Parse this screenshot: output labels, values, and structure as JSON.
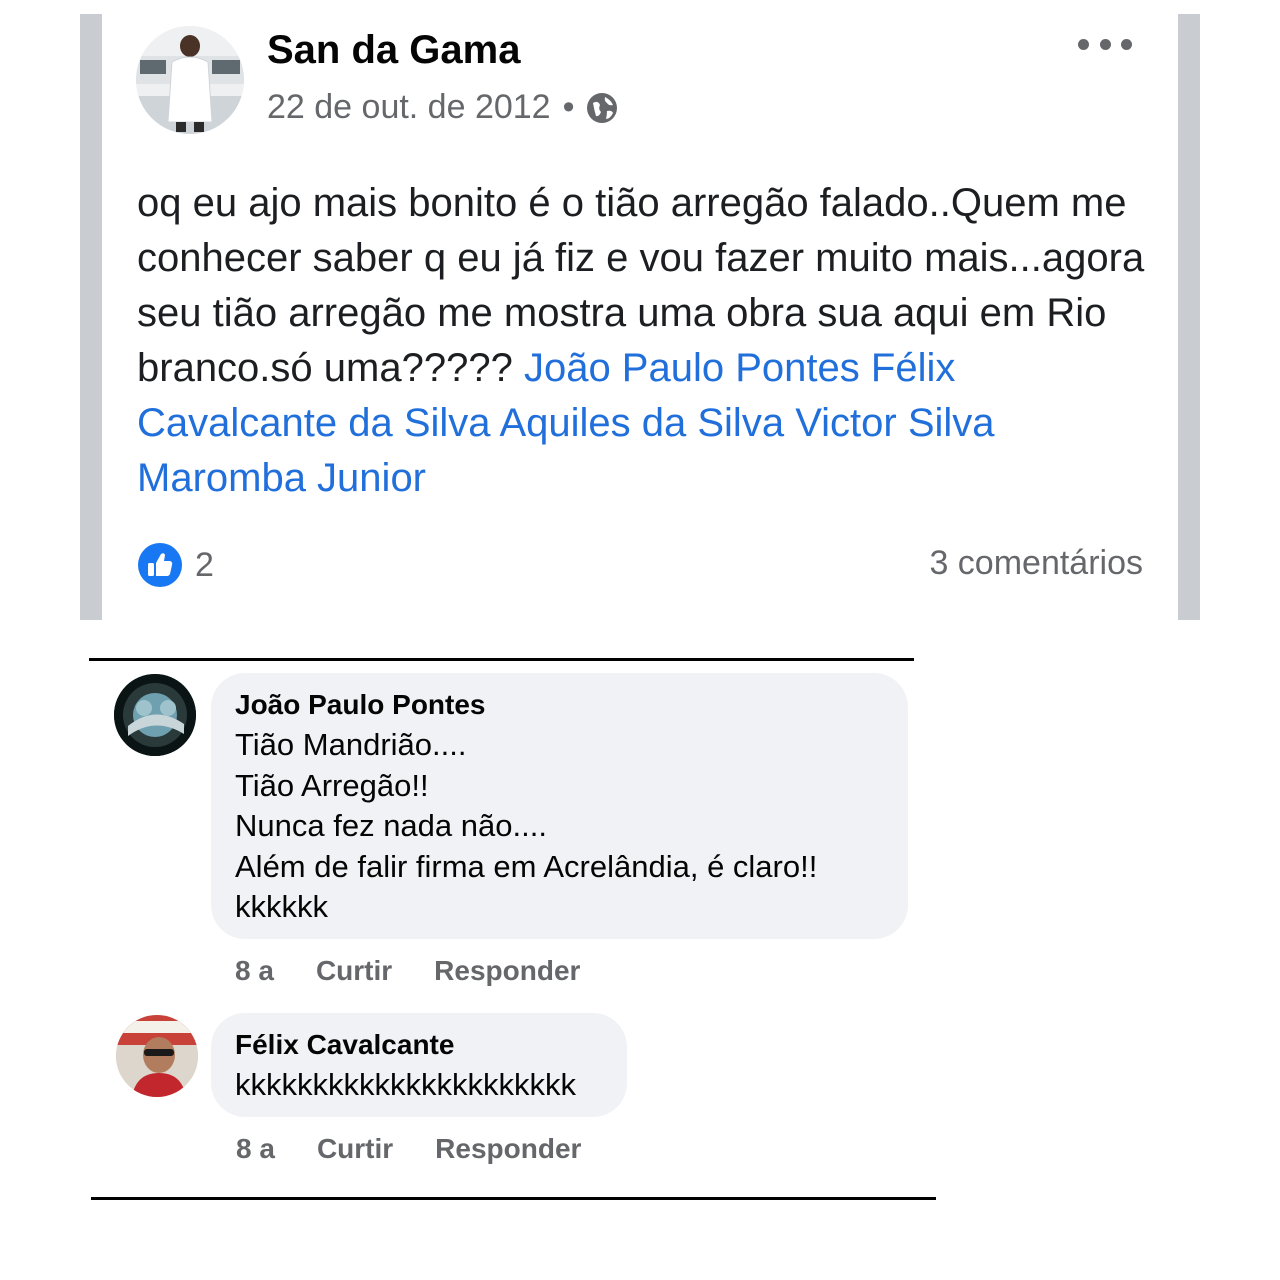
{
  "post": {
    "author": "San da Gama",
    "date": "22 de out. de 2012",
    "separator": "•",
    "privacy_icon": "globe-icon",
    "more_icon": "more-horizontal-icon",
    "text": "oq eu ajo  mais bonito é o tião arregão falado..Quem me conhecer saber q eu já fiz e vou fazer muito mais...agora seu tião arregão me mostra uma obra sua aqui em Rio branco.só uma?????",
    "mentions": [
      "João Paulo Pontes",
      "Félix Cavalcante da Silva",
      "Aquiles da Silva",
      "Victor Silva",
      "Maromba Junior"
    ],
    "like_icon": "thumbs-up-icon",
    "like_count": "2",
    "comments_count": "3 comentários"
  },
  "comments": [
    {
      "author": "João Paulo Pontes",
      "text": "Tião Mandrião....\nTião Arregão!!\nNunca fez nada não....\nAlém de falir firma em Acrelândia, é claro!!\nkkkkkk",
      "time": "8 a",
      "like_label": "Curtir",
      "reply_label": "Responder"
    },
    {
      "author": "Félix Cavalcante",
      "text": "kkkkkkkkkkkkkkkkkkkkkk",
      "time": "8 a",
      "like_label": "Curtir",
      "reply_label": "Responder"
    }
  ],
  "colors": {
    "mention_blue": "#216fdb",
    "like_blue": "#1877f2",
    "meta_gray": "#65676b",
    "bubble_bg": "#f0f2f5",
    "side_bar_gray": "#c9ccd1"
  }
}
